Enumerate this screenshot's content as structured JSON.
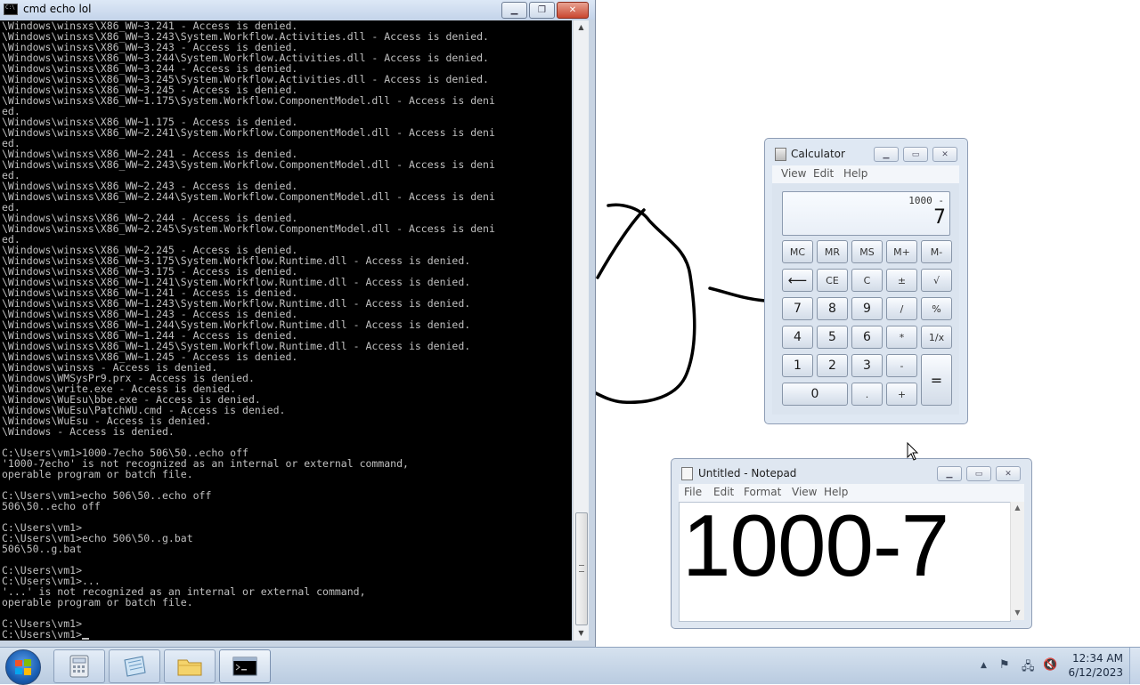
{
  "cmd": {
    "title": "cmd  echo lol",
    "lines": [
      "\\Windows\\winsxs\\X86_WW~3.241 - Access is denied.",
      "\\Windows\\winsxs\\X86_WW~3.243\\System.Workflow.Activities.dll - Access is denied.",
      "\\Windows\\winsxs\\X86_WW~3.243 - Access is denied.",
      "\\Windows\\winsxs\\X86_WW~3.244\\System.Workflow.Activities.dll - Access is denied.",
      "\\Windows\\winsxs\\X86_WW~3.244 - Access is denied.",
      "\\Windows\\winsxs\\X86_WW~3.245\\System.Workflow.Activities.dll - Access is denied.",
      "\\Windows\\winsxs\\X86_WW~3.245 - Access is denied.",
      "\\Windows\\winsxs\\X86_WW~1.175\\System.Workflow.ComponentModel.dll - Access is deni",
      "ed.",
      "\\Windows\\winsxs\\X86_WW~1.175 - Access is denied.",
      "\\Windows\\winsxs\\X86_WW~2.241\\System.Workflow.ComponentModel.dll - Access is deni",
      "ed.",
      "\\Windows\\winsxs\\X86_WW~2.241 - Access is denied.",
      "\\Windows\\winsxs\\X86_WW~2.243\\System.Workflow.ComponentModel.dll - Access is deni",
      "ed.",
      "\\Windows\\winsxs\\X86_WW~2.243 - Access is denied.",
      "\\Windows\\winsxs\\X86_WW~2.244\\System.Workflow.ComponentModel.dll - Access is deni",
      "ed.",
      "\\Windows\\winsxs\\X86_WW~2.244 - Access is denied.",
      "\\Windows\\winsxs\\X86_WW~2.245\\System.Workflow.ComponentModel.dll - Access is deni",
      "ed.",
      "\\Windows\\winsxs\\X86_WW~2.245 - Access is denied.",
      "\\Windows\\winsxs\\X86_WW~3.175\\System.Workflow.Runtime.dll - Access is denied.",
      "\\Windows\\winsxs\\X86_WW~3.175 - Access is denied.",
      "\\Windows\\winsxs\\X86_WW~1.241\\System.Workflow.Runtime.dll - Access is denied.",
      "\\Windows\\winsxs\\X86_WW~1.241 - Access is denied.",
      "\\Windows\\winsxs\\X86_WW~1.243\\System.Workflow.Runtime.dll - Access is denied.",
      "\\Windows\\winsxs\\X86_WW~1.243 - Access is denied.",
      "\\Windows\\winsxs\\X86_WW~1.244\\System.Workflow.Runtime.dll - Access is denied.",
      "\\Windows\\winsxs\\X86_WW~1.244 - Access is denied.",
      "\\Windows\\winsxs\\X86_WW~1.245\\System.Workflow.Runtime.dll - Access is denied.",
      "\\Windows\\winsxs\\X86_WW~1.245 - Access is denied.",
      "\\Windows\\winsxs - Access is denied.",
      "\\Windows\\WMSysPr9.prx - Access is denied.",
      "\\Windows\\write.exe - Access is denied.",
      "\\Windows\\WuEsu\\bbe.exe - Access is denied.",
      "\\Windows\\WuEsu\\PatchWU.cmd - Access is denied.",
      "\\Windows\\WuEsu - Access is denied.",
      "\\Windows - Access is denied.",
      "",
      "C:\\Users\\vm1>1000-7echo 506\\50..echo off",
      "'1000-7echo' is not recognized as an internal or external command,",
      "operable program or batch file.",
      "",
      "C:\\Users\\vm1>echo 506\\50..echo off",
      "506\\50..echo off",
      "",
      "C:\\Users\\vm1>",
      "C:\\Users\\vm1>echo 506\\50..g.bat",
      "506\\50..g.bat",
      "",
      "C:\\Users\\vm1>",
      "C:\\Users\\vm1>...",
      "'...' is not recognized as an internal or external command,",
      "operable program or batch file.",
      "",
      "C:\\Users\\vm1>",
      "C:\\Users\\vm1>"
    ]
  },
  "calculator": {
    "title": "Calculator",
    "menu": [
      "View",
      "Edit",
      "Help"
    ],
    "display": {
      "expression": "1000 -",
      "value": "7"
    },
    "keys": {
      "mc": "MC",
      "mr": "MR",
      "ms": "MS",
      "mplus": "M+",
      "mminus": "M-",
      "backspace": "⟵",
      "ce": "CE",
      "c": "C",
      "plusminus": "±",
      "sqrt": "√",
      "k7": "7",
      "k8": "8",
      "k9": "9",
      "divide": "/",
      "percent": "%",
      "k4": "4",
      "k5": "5",
      "k6": "6",
      "multiply": "*",
      "reciprocal": "1/x",
      "k1": "1",
      "k2": "2",
      "k3": "3",
      "minus": "-",
      "equals": "=",
      "k0": "0",
      "decimal": ".",
      "plus": "+"
    }
  },
  "notepad": {
    "title": "Untitled - Notepad",
    "menu": [
      "File",
      "Edit",
      "Format",
      "View",
      "Help"
    ],
    "content": "1000-7"
  },
  "taskbar": {
    "clock_time": "12:34 AM",
    "clock_date": "6/12/2023",
    "pinned": [
      "calculator-icon",
      "notepad-icon",
      "file-explorer-icon",
      "cmd-icon"
    ]
  }
}
